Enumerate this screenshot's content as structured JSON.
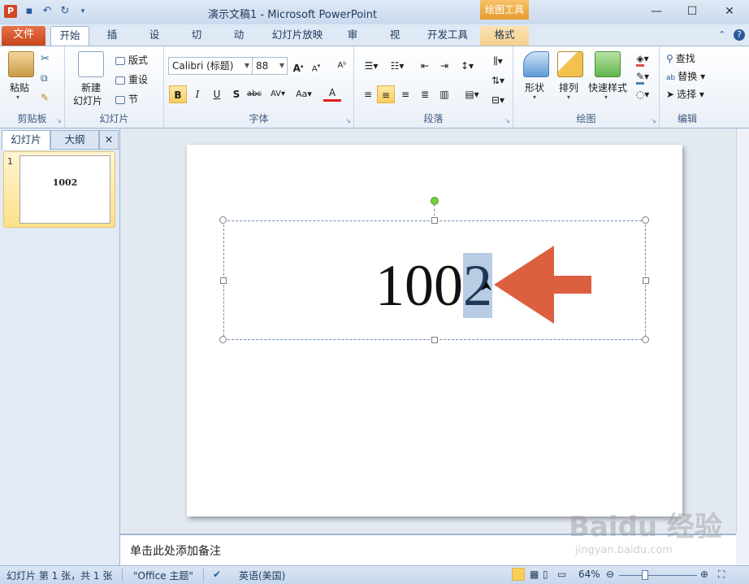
{
  "window": {
    "title": "演示文稿1 - Microsoft PowerPoint",
    "context_tab_group": "绘图工具",
    "app_icon_letter": "P"
  },
  "tabs": {
    "file": "文件",
    "items": [
      "开始",
      "插入",
      "设计",
      "切换",
      "动画",
      "幻灯片放映",
      "审阅",
      "视图",
      "开发工具",
      "格式"
    ],
    "active": "开始"
  },
  "ribbon": {
    "clipboard": {
      "label": "剪贴板",
      "paste": "粘贴"
    },
    "slides": {
      "label": "幻灯片",
      "new_slide_line1": "新建",
      "new_slide_line2": "幻灯片",
      "layout": "版式",
      "reset": "重设",
      "section": "节"
    },
    "font": {
      "label": "字体",
      "font_name": "Calibri (标题)",
      "font_size": "88"
    },
    "paragraph": {
      "label": "段落"
    },
    "drawing": {
      "label": "绘图",
      "shapes": "形状",
      "arrange": "排列",
      "quick_styles": "快速样式"
    },
    "editing": {
      "label": "编辑",
      "find": "查找",
      "replace": "替换",
      "select": "选择"
    }
  },
  "left_panel": {
    "tab_slides": "幻灯片",
    "tab_outline": "大纲",
    "thumb_number": "1",
    "thumb_text": "1002"
  },
  "slide": {
    "text_before": "100",
    "text_selected": "2",
    "arrow_color": "#dc6040"
  },
  "notes": {
    "placeholder": "单击此处添加备注"
  },
  "statusbar": {
    "slide_info": "幻灯片 第 1 张，共 1 张",
    "theme": "\"Office 主题\"",
    "language": "英语(美国)",
    "zoom": "64%"
  },
  "watermark": {
    "line1": "Baidu 经验",
    "line2": "jingyan.baidu.com"
  },
  "colors": {
    "file_tab": "#c64618",
    "context_tab": "#e69b2d",
    "selection": "#b8cce4",
    "rotation_handle": "#6fcf3f"
  }
}
